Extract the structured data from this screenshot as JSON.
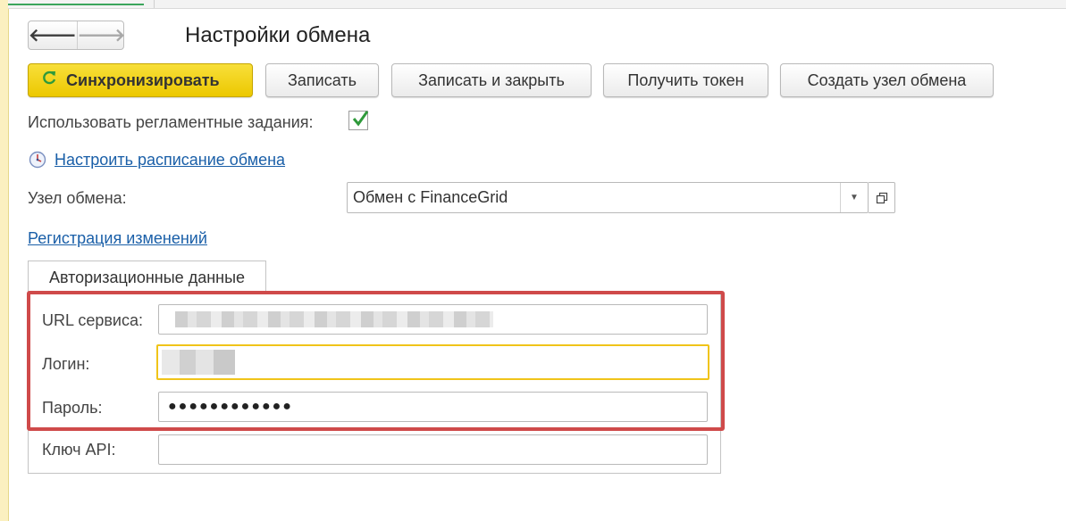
{
  "nav": {
    "back_glyph": "🡐",
    "forward_glyph": "🡒"
  },
  "page": {
    "title": "Настройки обмена"
  },
  "toolbar": {
    "sync_label": "Синхронизировать",
    "save_label": "Записать",
    "save_close_label": "Записать и закрыть",
    "get_token_label": "Получить токен",
    "create_node_label": "Создать узел обмена"
  },
  "scheduled": {
    "label": "Использовать регламентные задания:",
    "checked": true
  },
  "schedule_link": {
    "label": "Настроить расписание обмена"
  },
  "node": {
    "label": "Узел обмена:",
    "value": "Обмен с FinanceGrid"
  },
  "changes_link": {
    "label": "Регистрация изменений"
  },
  "tab": {
    "label": "Авторизационные данные"
  },
  "fields": {
    "url_label": "URL сервиса:",
    "login_label": "Логин:",
    "password_label": "Пароль:",
    "password_value": "●●●●●●●●●●●●",
    "api_key_label": "Ключ API:",
    "api_key_value": ""
  },
  "colors": {
    "primary_button": "#ecc800",
    "link": "#1a5fa8",
    "highlight_border": "#cf4a4a",
    "focus_border": "#f0c419",
    "check_mark": "#2f9a3b"
  }
}
